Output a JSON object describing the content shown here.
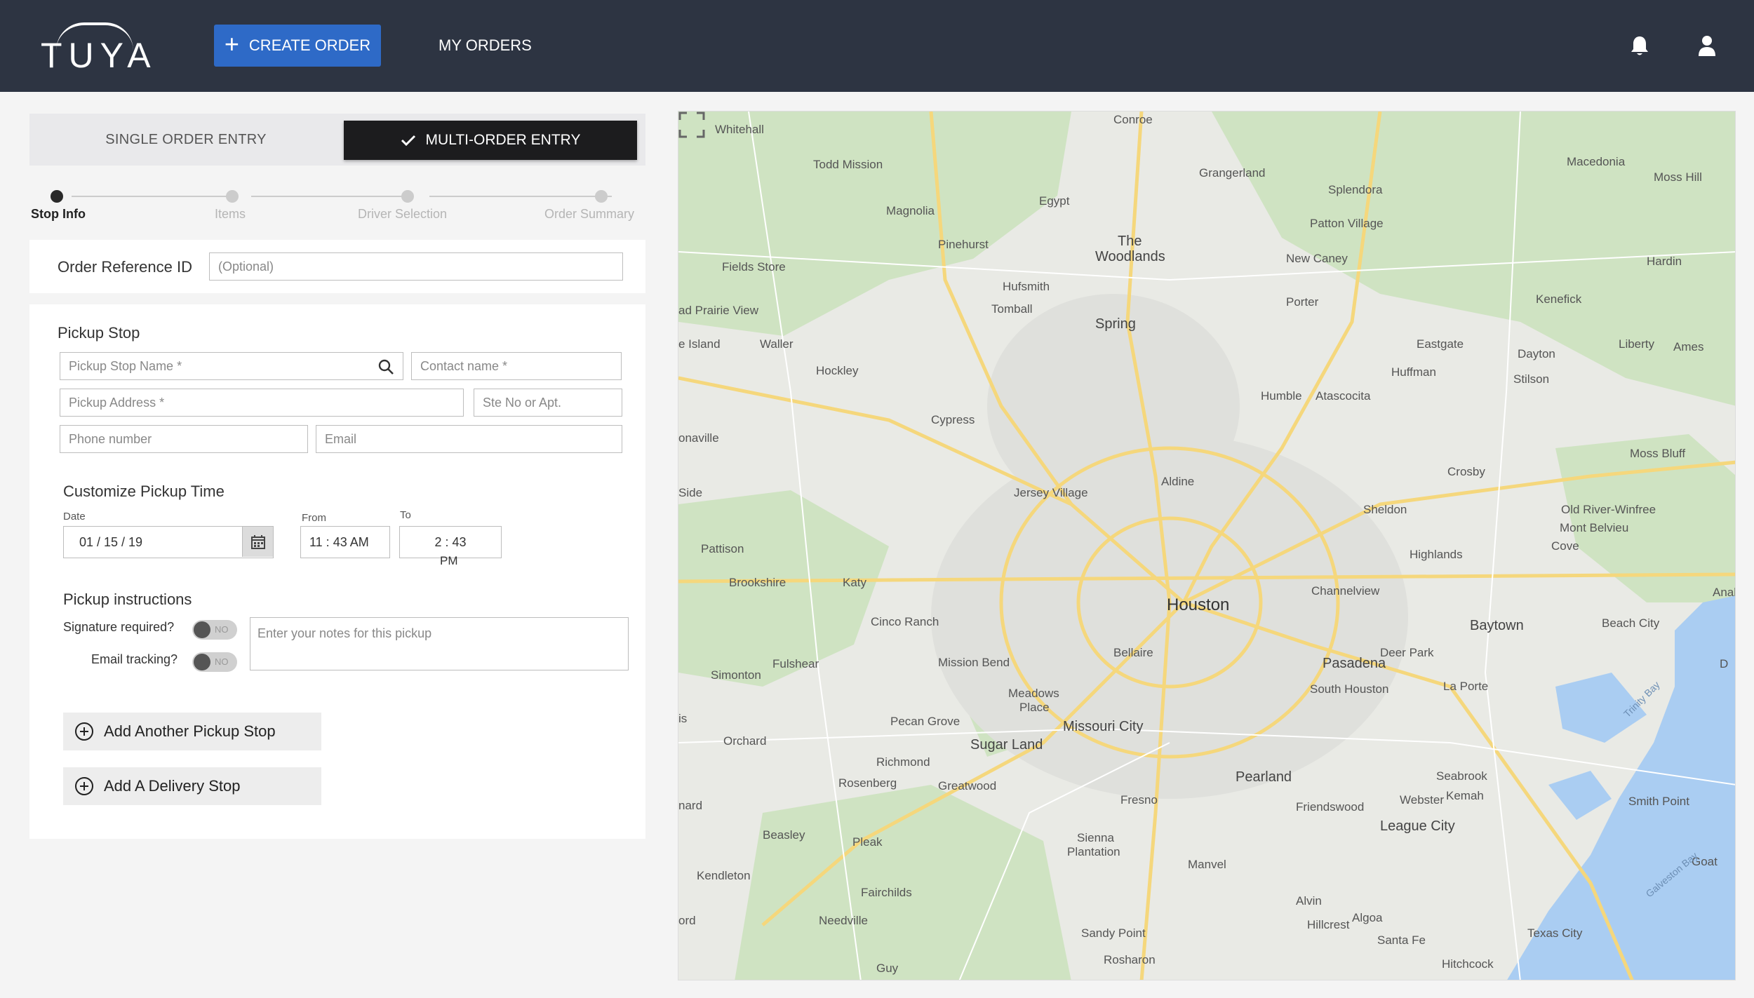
{
  "header": {
    "logo_text": "TUYA",
    "create_order_label": "CREATE ORDER",
    "my_orders_label": "MY ORDERS"
  },
  "entry_mode": {
    "single_label": "SINGLE ORDER ENTRY",
    "multi_label": "MULTI-ORDER ENTRY",
    "selected": "multi"
  },
  "stepper": {
    "steps": [
      "Stop Info",
      "Items",
      "Driver Selection",
      "Order Summary"
    ],
    "active_index": 0
  },
  "order_reference": {
    "label": "Order Reference ID",
    "placeholder": "(Optional)"
  },
  "pickup": {
    "title": "Pickup Stop",
    "stop_name_placeholder": "Pickup Stop Name *",
    "contact_placeholder": "Contact name *",
    "address_placeholder": "Pickup Address *",
    "suite_placeholder": "Ste No or Apt.",
    "phone_placeholder": "Phone number",
    "email_placeholder": "Email"
  },
  "pickup_time": {
    "title": "Customize Pickup Time",
    "date_label": "Date",
    "date_value": "01 / 15 / 19",
    "from_label": "From",
    "from_value": "11 : 43  AM",
    "to_label": "To",
    "to_value_line1": "2 : 43",
    "to_value_line2": "PM"
  },
  "instructions": {
    "title": "Pickup instructions",
    "signature_label": "Signature required?",
    "signature_value": "NO",
    "email_tracking_label": "Email tracking?",
    "email_tracking_value": "NO",
    "notes_placeholder": "Enter your notes for this pickup"
  },
  "actions": {
    "add_pickup_label": "Add Another Pickup Stop",
    "add_delivery_label": "Add A Delivery Stop"
  },
  "map": {
    "labels": {
      "houston": "Houston",
      "the_woodlands_1": "The",
      "the_woodlands_2": "Woodlands",
      "spring": "Spring",
      "pasadena": "Pasadena",
      "baytown": "Baytown",
      "pearland": "Pearland",
      "sugar_land": "Sugar Land",
      "missouri_city": "Missouri City",
      "league_city": "League City",
      "conroe": "Conroe",
      "whitehall": "Whitehall",
      "todd_mission": "Todd Mission",
      "grangerland": "Grangerland",
      "macedonia": "Macedonia",
      "moss_hill": "Moss Hill",
      "magnolia": "Magnolia",
      "egypt": "Egypt",
      "splendora": "Splendora",
      "patton_village": "Patton Village",
      "pinehurst": "Pinehurst",
      "new_caney": "New Caney",
      "hardin": "Hardin",
      "fields_store": "Fields Store",
      "hufsmith": "Hufsmith",
      "tomball": "Tomball",
      "porter": "Porter",
      "kenefick": "Kenefick",
      "prairie_view": "ad Prairie View",
      "waller": "Waller",
      "eastgate": "Eastgate",
      "dayton": "Dayton",
      "liberty": "Liberty",
      "ames": "Ames",
      "island": "e Island",
      "hockley": "Hockley",
      "huffman": "Huffman",
      "stilson": "Stilson",
      "humble": "Humble",
      "atascocita": "Atascocita",
      "cypress": "Cypress",
      "onaville": "onaville",
      "moss_bluff": "Moss Bluff",
      "aldine": "Aldine",
      "crosby": "Crosby",
      "side": "Side",
      "jersey_village": "Jersey Village",
      "sheldon": "Sheldon",
      "old_river": "Old River-Winfree",
      "mont_belvieu": "Mont Belvieu",
      "pattison": "Pattison",
      "highlands": "Highlands",
      "cove": "Cove",
      "brookshire": "Brookshire",
      "katy": "Katy",
      "channelview": "Channelview",
      "anahu": "Anahu",
      "cinco_ranch": "Cinco Ranch",
      "beach_city": "Beach City",
      "bellaire": "Bellaire",
      "deer_park": "Deer Park",
      "fulshear": "Fulshear",
      "mission_bend": "Mission Bend",
      "simonton": "Simonton",
      "south_houston": "South Houston",
      "la_porte": "La Porte",
      "meadows_1": "Meadows",
      "meadows_2": "Place",
      "pecan_grove": "Pecan Grove",
      "orchard": "Orchard",
      "richmond": "Richmond",
      "rosenberg": "Rosenberg",
      "greatwood": "Greatwood",
      "seabrook": "Seabrook",
      "kemah": "Kemah",
      "nard": "nard",
      "fresno": "Fresno",
      "friendswood": "Friendswood",
      "webster": "Webster",
      "smith_point": "Smith Point",
      "beasley": "Beasley",
      "pleak": "Pleak",
      "sienna_1": "Sienna",
      "sienna_2": "Plantation",
      "manvel": "Manvel",
      "goat": "Goat",
      "kendleton": "Kendleton",
      "fairchilds": "Fairchilds",
      "alvin": "Alvin",
      "algoa": "Algoa",
      "hillcrest": "Hillcrest",
      "texas_city": "Texas City",
      "ord": "ord",
      "needville": "Needville",
      "sandy_point": "Sandy Point",
      "santa_fe": "Santa Fe",
      "rosharon": "Rosharon",
      "hitchcock": "Hitchcock",
      "guy": "Guy",
      "trinity_bay": "Trinity Bay",
      "galveston_bay": "Galveston Bay",
      "is": "is",
      "d": "D"
    },
    "colors": {
      "land": "#e9eae5",
      "green": "#cfe3c2",
      "water": "#aacdf2",
      "highway": "#f5d77c",
      "road": "#ffffff"
    }
  },
  "colors": {
    "header_bg": "#2d3442",
    "primary": "#2e6ac7",
    "selected_toggle": "#1c1c1e"
  }
}
